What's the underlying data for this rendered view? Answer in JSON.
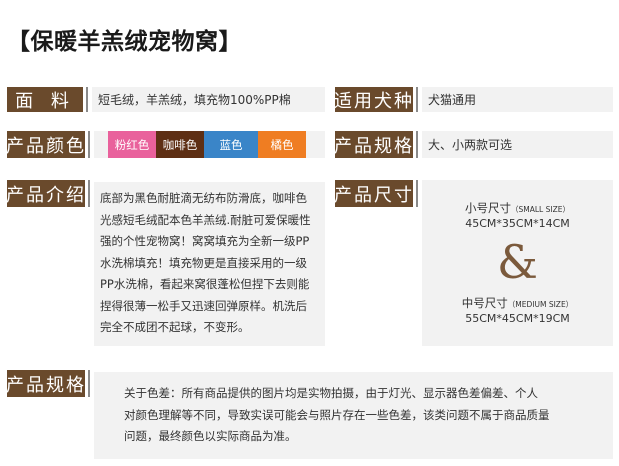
{
  "page_title": "【保暖羊羔绒宠物窝】",
  "fields": {
    "fabric": {
      "label": "面  料",
      "value": "短毛绒，羊羔绒，填充物100%PP棉"
    },
    "suitable": {
      "label": "适用犬种",
      "value": "犬猫通用"
    },
    "colors": {
      "label": "产品颜色",
      "items": [
        {
          "name": "粉红色",
          "color": "#e9619c"
        },
        {
          "name": "咖啡色",
          "color": "#5e2f14"
        },
        {
          "name": "蓝色",
          "color": "#3a85c8"
        },
        {
          "name": "橘色",
          "color": "#ef7d22"
        }
      ]
    },
    "specs": {
      "label": "产品规格",
      "value": "大、小两款可选"
    },
    "intro": {
      "label": "产品介绍",
      "lines": [
        "底部为黑色耐脏滴无纺布防滑底，咖啡色",
        "光感短毛绒配本色羊羔绒.耐脏可爱保暖性",
        "强的个性宠物窝！窝窝填充为全新一级PP",
        "水洗棉填充！填充物更是直接采用的一级",
        "PP水洗棉，看起来窝很蓬松但捏下去则能",
        "捏得很薄一松手又迅速回弹原样。机洗后",
        "完全不成团不起球，不变形。"
      ]
    },
    "size": {
      "label": "产品尺寸",
      "small_title": "小号尺寸",
      "small_tag": "（SMALL SIZE）",
      "small_dims": "45CM*35CM*14CM",
      "amp": "&",
      "medium_title": "中号尺寸",
      "medium_tag": "（MEDIUM SIZE）",
      "medium_dims": "55CM*45CM*19CM"
    },
    "note": {
      "label": "产品规格",
      "lines": [
        "关于色差：所有商品提供的图片均是实物拍摄，由于灯光、显示器色差偏差、个人",
        "对颜色理解等不同，导致实误可能会与照片存在一些色差，该类问题不属于商品质量",
        "问题，最终颜色以实际商品为准。"
      ]
    }
  }
}
